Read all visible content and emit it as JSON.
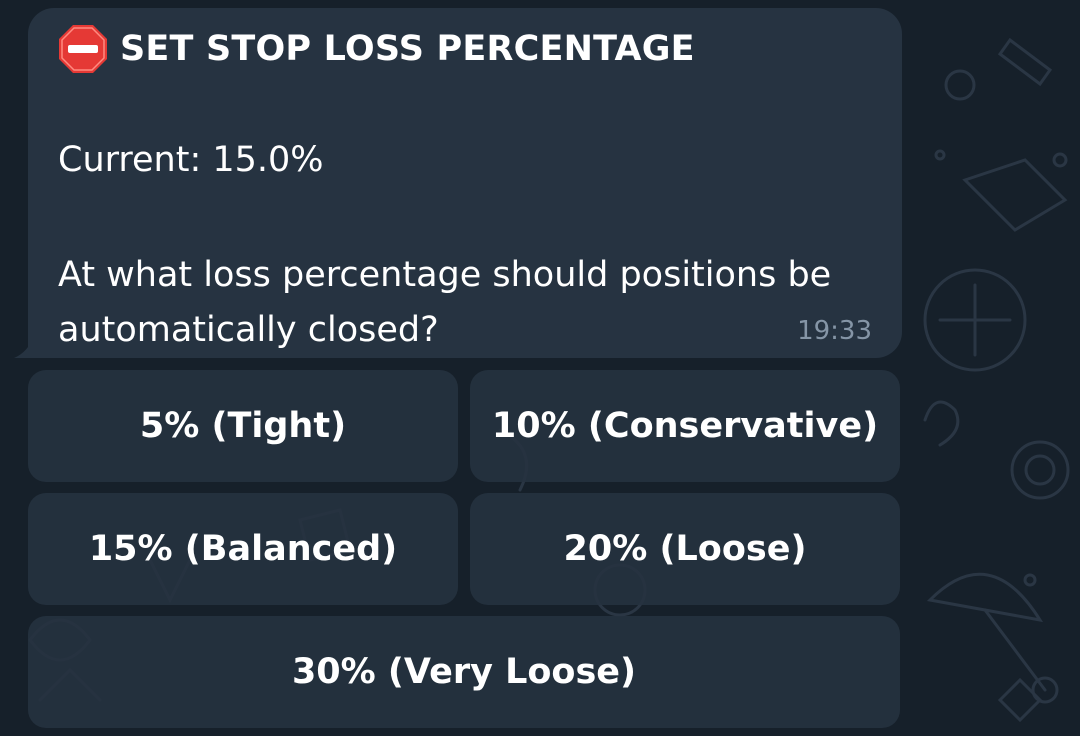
{
  "message": {
    "title_icon": "stop-sign-icon",
    "title": "SET STOP LOSS PERCENTAGE",
    "current": "Current: 15.0%",
    "question": "At what loss percentage should positions be automatically closed?",
    "time": "19:33"
  },
  "keyboard": {
    "buttons": [
      {
        "label": "5% (Tight)"
      },
      {
        "label": "10% (Conservative)"
      },
      {
        "label": "15% (Balanced)"
      },
      {
        "label": "20% (Loose)"
      },
      {
        "label": "30% (Very Loose)"
      }
    ]
  },
  "colors": {
    "background": "#16202a",
    "bubble": "#263341",
    "button": "#253240",
    "text": "#ffffff",
    "time": "#8595a6",
    "stop_icon": "#e53935"
  }
}
